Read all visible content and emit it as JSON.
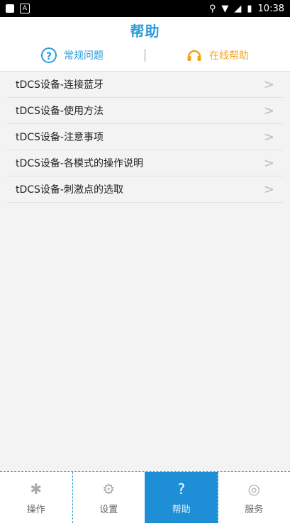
{
  "status": {
    "time": "10:38"
  },
  "header": {
    "title": "帮助"
  },
  "tabs": [
    {
      "label": "常规问题"
    },
    {
      "label": "在线帮助"
    }
  ],
  "list": [
    {
      "label": "tDCS设备-连接蓝牙"
    },
    {
      "label": "tDCS设备-使用方法"
    },
    {
      "label": "tDCS设备-注意事项"
    },
    {
      "label": "tDCS设备-各模式的操作说明"
    },
    {
      "label": "tDCS设备-刺激点的选取"
    }
  ],
  "nav": [
    {
      "label": "操作"
    },
    {
      "label": "设置"
    },
    {
      "label": "帮助"
    },
    {
      "label": "服务"
    }
  ],
  "colors": {
    "accent": "#2a9bd9",
    "online": "#f0a41d",
    "active_tab_bg": "#1e8fd6"
  }
}
